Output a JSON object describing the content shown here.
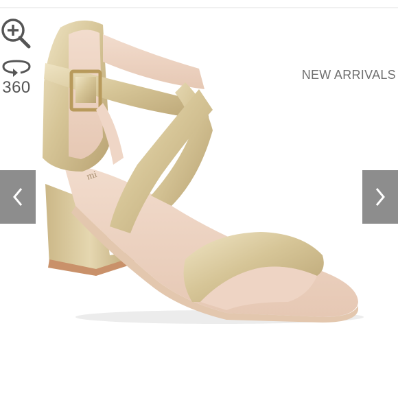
{
  "viewer": {
    "zoom_icon": "zoom-in-icon",
    "rotate_icon": "rotate-360-icon",
    "rotate_label": "360",
    "badge": "NEW ARRIVALS",
    "prev_icon": "chevron-left-icon",
    "next_icon": "chevron-right-icon"
  },
  "product_image": {
    "insole_brand": "mi",
    "color_main": "#d8c9a0",
    "color_lining": "#eed4c4",
    "color_sole": "#c9916a"
  }
}
